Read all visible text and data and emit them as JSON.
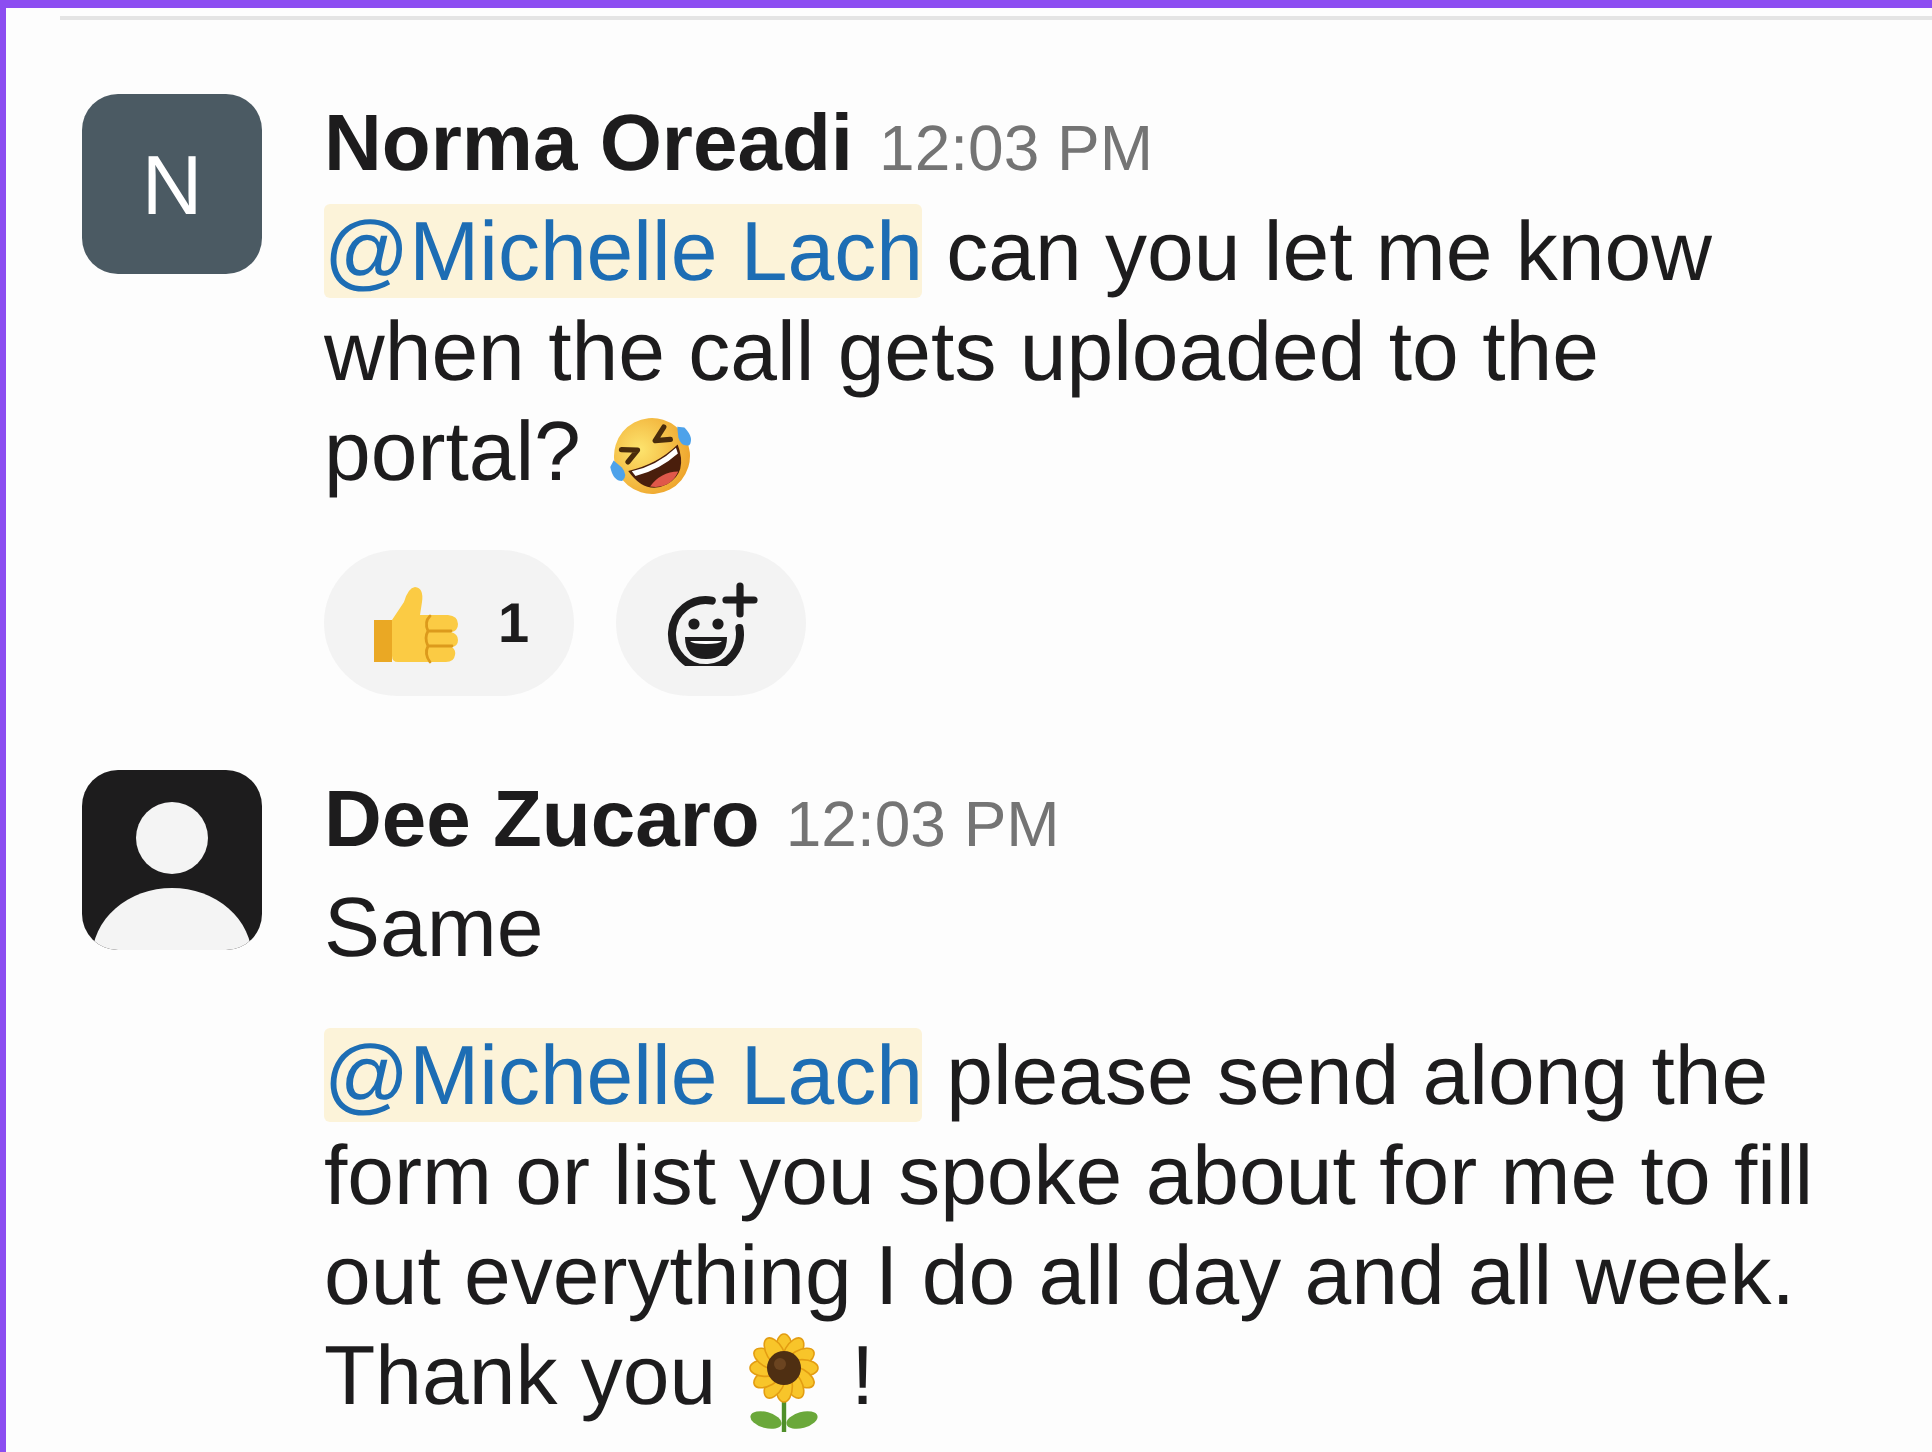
{
  "messages": [
    {
      "avatar": {
        "kind": "initial",
        "initial": "N"
      },
      "author": "Norma Oreadi",
      "time": "12:03 PM",
      "paragraphs": [
        [
          {
            "kind": "mention",
            "text": "@Michelle Lach"
          },
          {
            "kind": "text",
            "text": " can you let me know when the call gets uploaded to the portal? "
          },
          {
            "kind": "laughing"
          }
        ]
      ],
      "reactions": [
        {
          "kind": "thumbsup",
          "count": "1"
        },
        {
          "kind": "add"
        }
      ]
    },
    {
      "avatar": {
        "kind": "silhouette"
      },
      "author": "Dee Zucaro",
      "time": "12:03 PM",
      "paragraphs": [
        [
          {
            "kind": "text",
            "text": "Same"
          }
        ],
        [
          {
            "kind": "mention",
            "text": "@Michelle Lach"
          },
          {
            "kind": "text",
            "text": " please send along the form or list you spoke about for me to fill out everything I do all day and all week. Thank you "
          },
          {
            "kind": "sunflower"
          },
          {
            "kind": "text",
            "text": " !"
          }
        ]
      ]
    }
  ]
}
